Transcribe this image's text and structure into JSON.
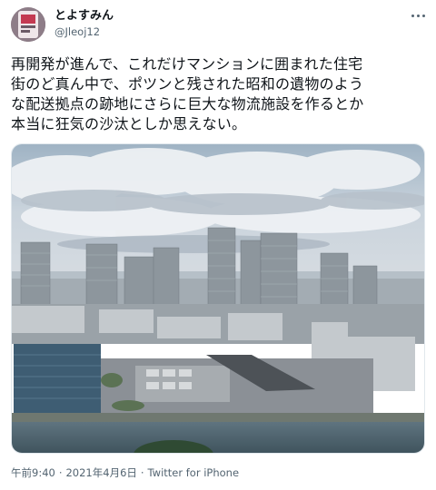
{
  "author": {
    "display_name": "とよすみん",
    "handle": "@Jleoj12"
  },
  "tweet": {
    "text_lines": [
      "再開発が進んで、これだけマンションに囲まれた住宅",
      "街のど真ん中で、ポツンと残された昭和の遺物のよう",
      "な配送拠点の跡地にさらに巨大な物流施設を作るとか",
      "本当に狂気の沙汰としか思えない。"
    ]
  },
  "meta": {
    "time": "午前9:40",
    "separator": "·",
    "date": "2021年4月6日",
    "source": "Twitter for iPhone"
  },
  "icons": {
    "more": "more-horizontal-icon",
    "avatar": "avatar-image"
  },
  "colors": {
    "text": "#0f1419",
    "secondary": "#536471"
  }
}
